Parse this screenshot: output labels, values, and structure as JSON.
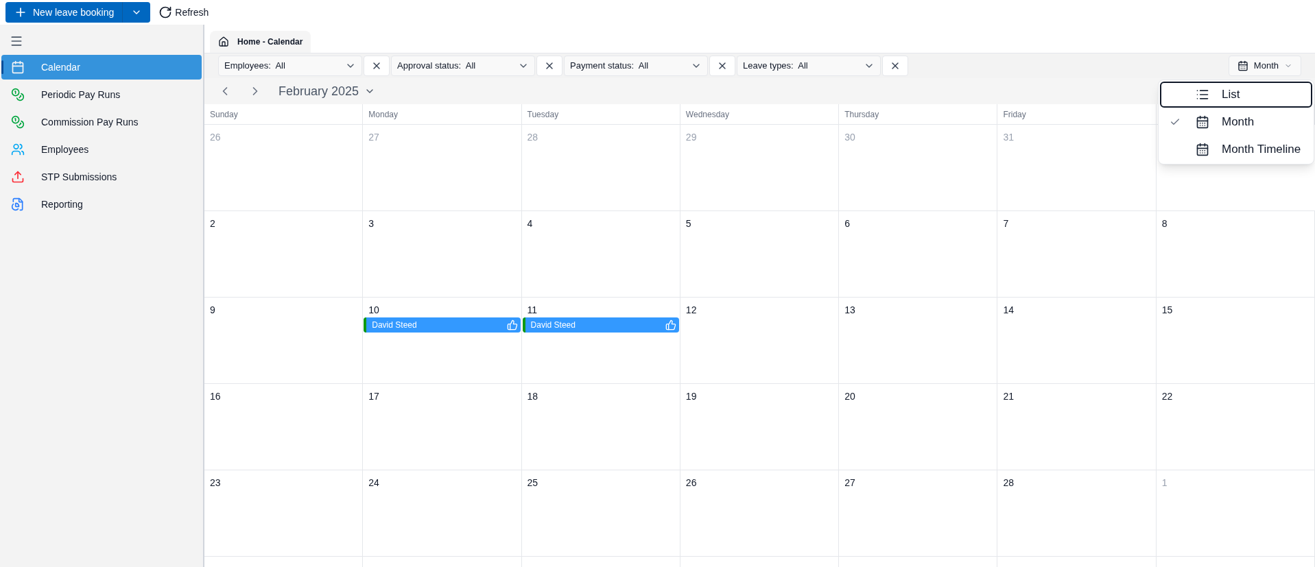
{
  "toolbar": {
    "primary_button": "New leave booking",
    "refresh_button": "Refresh"
  },
  "sidebar": {
    "items": [
      {
        "label": "Calendar",
        "selected": true
      },
      {
        "label": "Periodic Pay Runs",
        "selected": false
      },
      {
        "label": "Commission Pay Runs",
        "selected": false
      },
      {
        "label": "Employees",
        "selected": false
      },
      {
        "label": "STP Submissions",
        "selected": false
      },
      {
        "label": "Reporting",
        "selected": false
      }
    ]
  },
  "tab": {
    "label": "Home - Calendar"
  },
  "filters": [
    {
      "label": "Employees:",
      "value": "All"
    },
    {
      "label": "Approval status:",
      "value": "All"
    },
    {
      "label": "Payment status:",
      "value": "All"
    },
    {
      "label": "Leave types:",
      "value": "All"
    }
  ],
  "view_button": {
    "label": "Month"
  },
  "view_menu": [
    {
      "label": "List",
      "selected": false,
      "focused": true
    },
    {
      "label": "Month",
      "selected": true,
      "focused": false
    },
    {
      "label": "Month Timeline",
      "selected": false,
      "focused": false
    }
  ],
  "month_title": "February 2025",
  "weekdays": [
    "Sunday",
    "Monday",
    "Tuesday",
    "Wednesday",
    "Thursday",
    "Friday"
  ],
  "weeks": [
    [
      {
        "day": "26",
        "muted": true
      },
      {
        "day": "27",
        "muted": true
      },
      {
        "day": "28",
        "muted": true
      },
      {
        "day": "29",
        "muted": true
      },
      {
        "day": "30",
        "muted": true
      },
      {
        "day": "31",
        "muted": true
      }
    ],
    [
      {
        "day": "2",
        "muted": false
      },
      {
        "day": "3",
        "muted": false
      },
      {
        "day": "4",
        "muted": false
      },
      {
        "day": "5",
        "muted": false
      },
      {
        "day": "6",
        "muted": false
      },
      {
        "day": "7",
        "muted": false
      },
      {
        "day": "8",
        "muted": false
      }
    ],
    [
      {
        "day": "9",
        "muted": false
      },
      {
        "day": "10",
        "muted": false,
        "events": [
          {
            "name": "David Steed",
            "color": "#109a10"
          }
        ]
      },
      {
        "day": "11",
        "muted": false,
        "events": [
          {
            "name": "David Steed",
            "color": "#109a10"
          }
        ]
      },
      {
        "day": "12",
        "muted": false
      },
      {
        "day": "13",
        "muted": false
      },
      {
        "day": "14",
        "muted": false
      },
      {
        "day": "15",
        "muted": false
      }
    ],
    [
      {
        "day": "16",
        "muted": false
      },
      {
        "day": "17",
        "muted": false
      },
      {
        "day": "18",
        "muted": false
      },
      {
        "day": "19",
        "muted": false
      },
      {
        "day": "20",
        "muted": false
      },
      {
        "day": "21",
        "muted": false
      },
      {
        "day": "22",
        "muted": false
      }
    ],
    [
      {
        "day": "23",
        "muted": false
      },
      {
        "day": "24",
        "muted": false
      },
      {
        "day": "25",
        "muted": false
      },
      {
        "day": "26",
        "muted": false
      },
      {
        "day": "27",
        "muted": false
      },
      {
        "day": "28",
        "muted": false
      },
      {
        "day": "1",
        "muted": true
      }
    ]
  ]
}
